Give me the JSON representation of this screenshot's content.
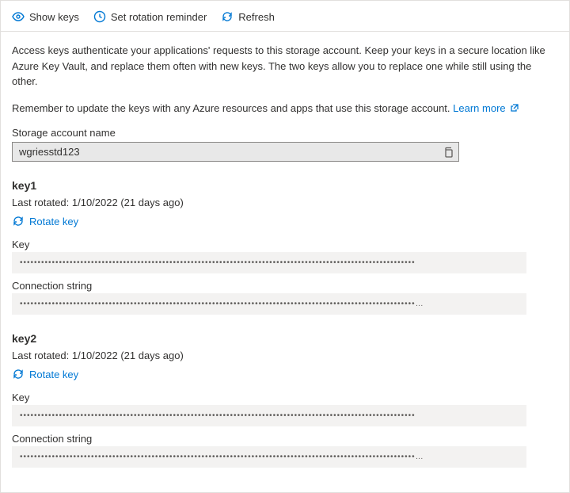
{
  "toolbar": {
    "show_keys": "Show keys",
    "set_rotation": "Set rotation reminder",
    "refresh": "Refresh"
  },
  "description": {
    "p1": "Access keys authenticate your applications' requests to this storage account. Keep your keys in a secure location like Azure Key Vault, and replace them often with new keys. The two keys allow you to replace one while still using the other.",
    "p2_prefix": "Remember to update the keys with any Azure resources and apps that use this storage account. ",
    "learn_more": "Learn more"
  },
  "storage_account": {
    "label": "Storage account name",
    "value": "wgriesstd123"
  },
  "keys": [
    {
      "title": "key1",
      "last_rotated": "Last rotated: 1/10/2022 (21 days ago)",
      "rotate_label": "Rotate key",
      "key_label": "Key",
      "key_masked": "•••••••••••••••••••••••••••••••••••••••••••••••••••••••••••••••••••••••••••••••••••••••••••••••••••••••••••••••",
      "conn_label": "Connection string",
      "conn_masked": "•••••••••••••••••••••••••••••••••••••••••••••••••••••••••••••••••••••••••••••••••••••••••••••••••••••••••••••••…"
    },
    {
      "title": "key2",
      "last_rotated": "Last rotated: 1/10/2022 (21 days ago)",
      "rotate_label": "Rotate key",
      "key_label": "Key",
      "key_masked": "•••••••••••••••••••••••••••••••••••••••••••••••••••••••••••••••••••••••••••••••••••••••••••••••••••••••••••••••",
      "conn_label": "Connection string",
      "conn_masked": "•••••••••••••••••••••••••••••••••••••••••••••••••••••••••••••••••••••••••••••••••••••••••••••••••••••••••••••••…"
    }
  ]
}
